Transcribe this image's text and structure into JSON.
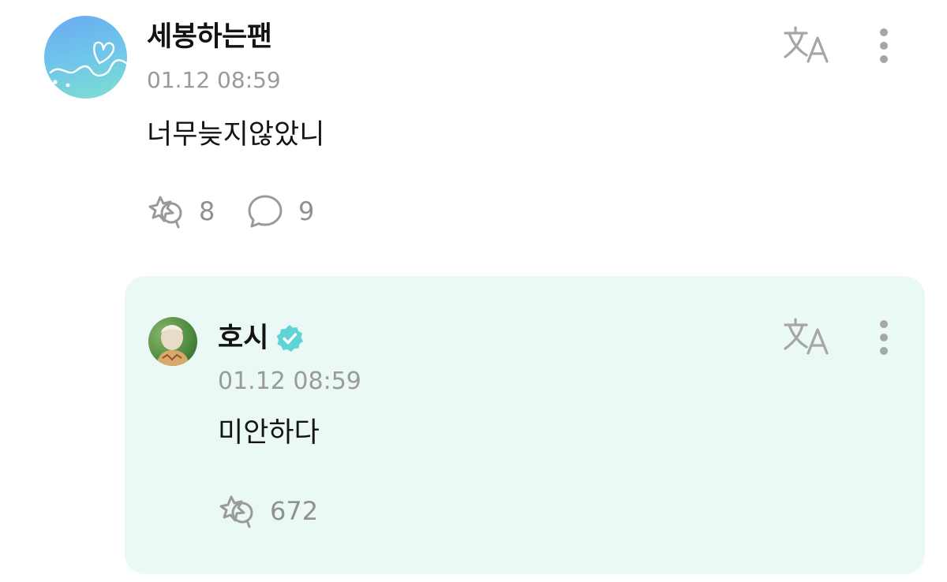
{
  "comment": {
    "author": "세봉하는팬",
    "timestamp": "01.12 08:59",
    "text": "너무늦지않았니",
    "like_count": "8",
    "reply_count": "9",
    "avatar_icon": "heart-ribbon-avatar",
    "translate_icon": "translate-icon",
    "more_icon": "more-vertical-icon"
  },
  "reply": {
    "author": "호시",
    "verified": true,
    "timestamp": "01.12 08:59",
    "text": "미안하다",
    "like_count": "672",
    "avatar_icon": "profile-photo",
    "translate_icon": "translate-icon",
    "more_icon": "more-vertical-icon"
  },
  "colors": {
    "reply_background": "#eaf8f6",
    "verified_badge": "#5fd3d6",
    "muted_text": "#9a9a9a",
    "icon_gray": "#a6a6a6"
  }
}
